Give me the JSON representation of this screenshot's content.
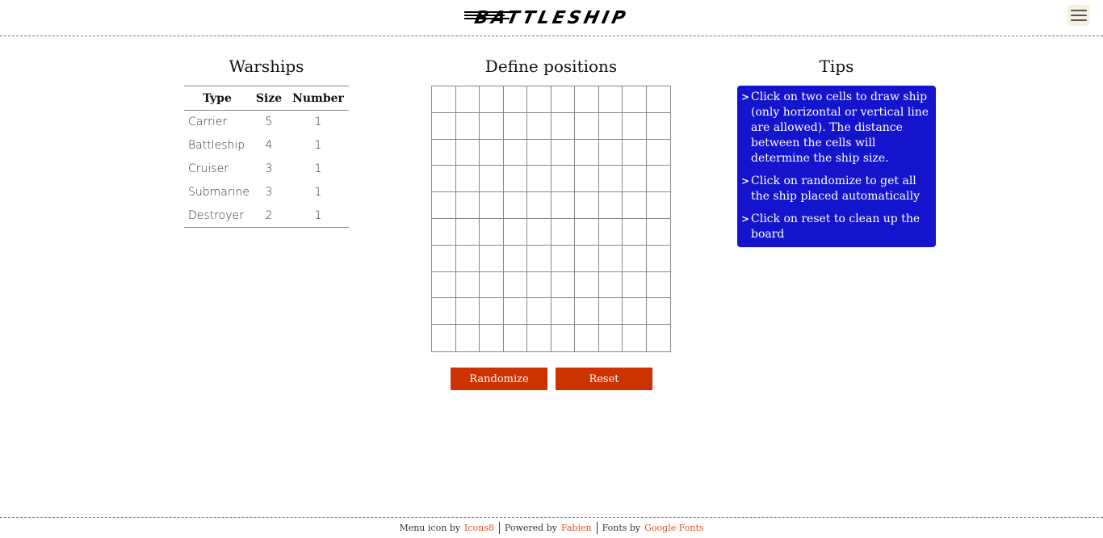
{
  "header": {
    "logo_text": "BATTLESHIP",
    "menu_icon": "hamburger-menu-icon"
  },
  "warships": {
    "title": "Warships",
    "columns": [
      "Type",
      "Size",
      "Number"
    ],
    "rows": [
      {
        "type": "Carrier",
        "size": "5",
        "number": "1"
      },
      {
        "type": "Battleship",
        "size": "4",
        "number": "1"
      },
      {
        "type": "Cruiser",
        "size": "3",
        "number": "1"
      },
      {
        "type": "Submarine",
        "size": "3",
        "number": "1"
      },
      {
        "type": "Destroyer",
        "size": "2",
        "number": "1"
      }
    ]
  },
  "board": {
    "title": "Define positions",
    "rows": 10,
    "cols": 10,
    "randomize_label": "Randomize",
    "reset_label": "Reset"
  },
  "tips": {
    "title": "Tips",
    "items": [
      "Click on two cells to draw ship (only horizontal or vertical line are allowed). The distance between the cells will determine the ship size.",
      "Click on randomize to get all the ship placed automatically",
      "Click on reset to clean up the board"
    ]
  },
  "footer": {
    "menu_icon_prefix": "Menu icon by",
    "menu_icon_link": "Icons8",
    "powered_prefix": "Powered by",
    "powered_link": "Fabien",
    "fonts_prefix": "Fonts by",
    "fonts_link": "Google Fonts"
  },
  "colors": {
    "button": "#cc3300",
    "tips_bg": "#1414cc",
    "link": "#e0502a"
  }
}
